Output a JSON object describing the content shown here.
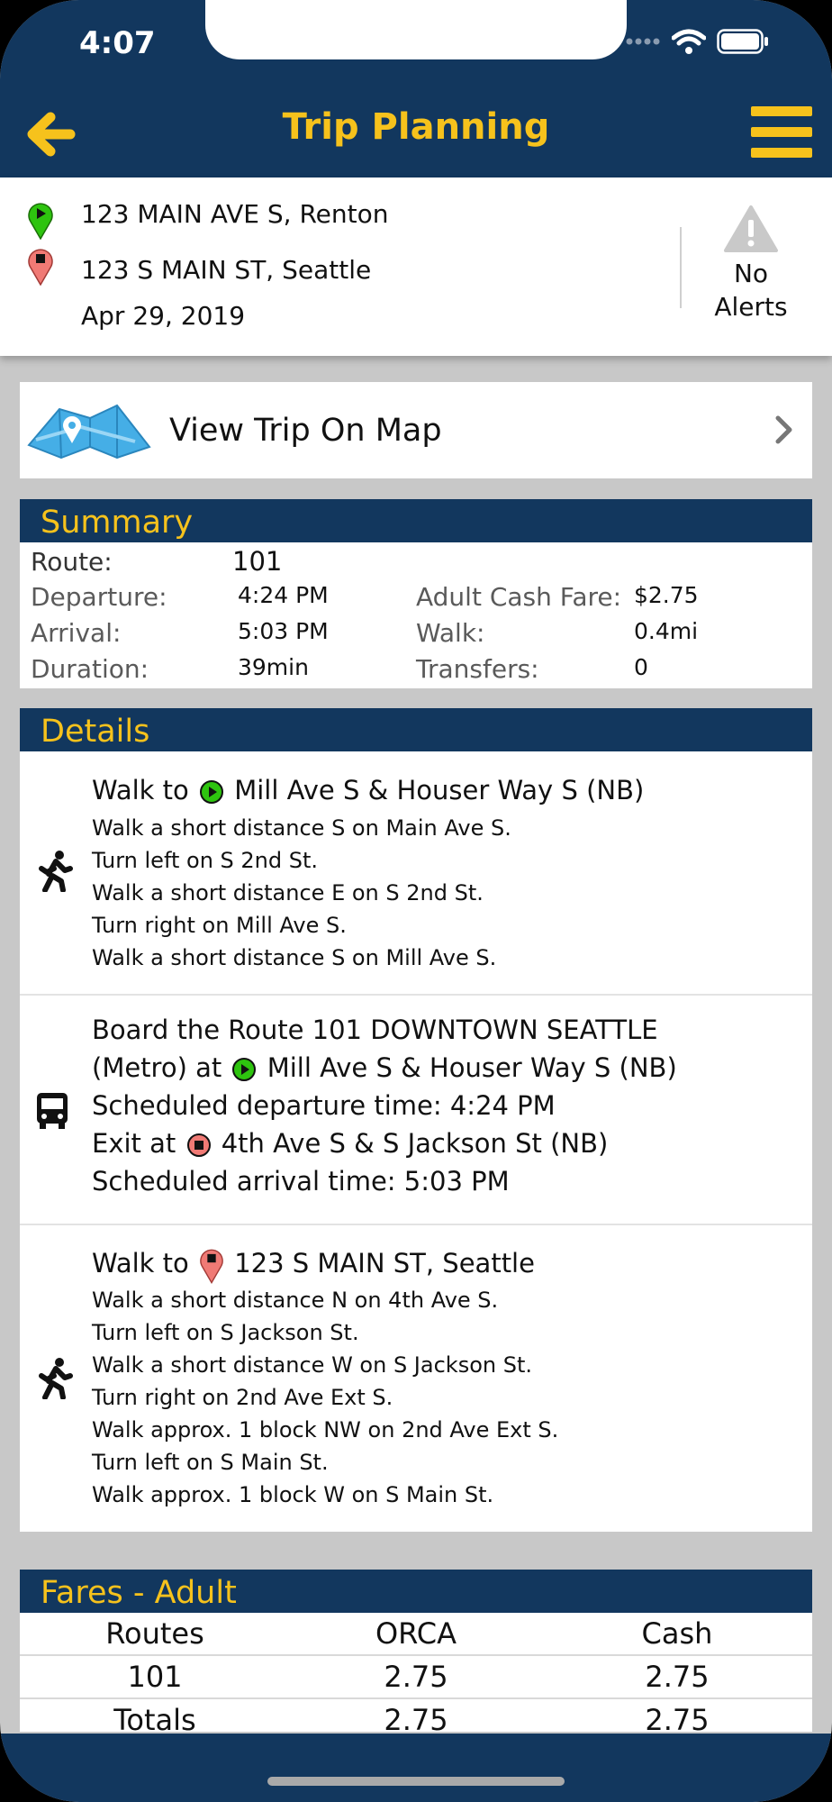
{
  "status": {
    "time": "4:07"
  },
  "nav": {
    "title": "Trip Planning"
  },
  "trip": {
    "origin": "123 MAIN AVE S, Renton",
    "destination": "123 S MAIN ST, Seattle",
    "date": "Apr 29, 2019"
  },
  "alerts": {
    "line1": "No",
    "line2": "Alerts"
  },
  "map_link": {
    "label": "View Trip On Map"
  },
  "summary": {
    "title": "Summary",
    "route_label": "Route:",
    "route_value": "101",
    "departure_label": "Departure:",
    "departure_value": "4:24 PM",
    "arrival_label": "Arrival:",
    "arrival_value": "5:03 PM",
    "duration_label": "Duration:",
    "duration_value": "39min",
    "fare_label": "Adult Cash Fare:",
    "fare_value": "$2.75",
    "walk_label": "Walk:",
    "walk_value": "0.4mi",
    "transfers_label": "Transfers:",
    "transfers_value": "0"
  },
  "details": {
    "title": "Details",
    "walk1": {
      "prefix": "Walk to",
      "stop": "Mill Ave S & Houser Way S (NB)",
      "lines": [
        "Walk a short distance S on Main Ave S.",
        "Turn left on S 2nd St.",
        "Walk a short distance E on S 2nd St.",
        "Turn right on Mill Ave S.",
        "Walk a short distance S on Mill Ave S."
      ]
    },
    "bus": {
      "line1": "Board the Route   101 DOWNTOWN SEATTLE",
      "line2_prefix": "(Metro) at",
      "line2_stop": "Mill Ave S & Houser Way S (NB)",
      "line3": "Scheduled departure time:  4:24 PM",
      "line4_prefix": "Exit at",
      "line4_stop": "4th Ave S & S Jackson St (NB)",
      "line5": "Scheduled arrival time:  5:03 PM"
    },
    "walk2": {
      "prefix": "Walk to",
      "stop": "123 S MAIN ST, Seattle",
      "lines": [
        "Walk a short distance N on 4th Ave S.",
        "Turn left on S Jackson St.",
        "Walk a short distance W on S Jackson St.",
        "Turn right on 2nd Ave Ext S.",
        "Walk approx. 1 block NW on 2nd Ave Ext S.",
        "Turn left on S Main St.",
        "Walk approx. 1 block W on S Main St."
      ]
    }
  },
  "fares": {
    "title": "Fares - Adult",
    "columns": [
      "Routes",
      "ORCA",
      "Cash"
    ],
    "rows": [
      [
        "101",
        "2.75",
        "2.75"
      ],
      [
        "Totals",
        "2.75",
        "2.75"
      ]
    ]
  },
  "colors": {
    "header_bg": "#12375e",
    "accent": "#f6c21c",
    "origin_pin": "#2ec40f",
    "dest_pin": "#f07a75"
  }
}
